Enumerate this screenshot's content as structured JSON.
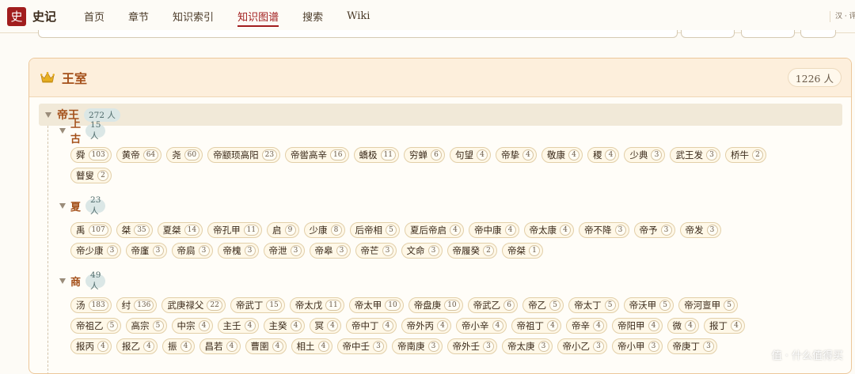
{
  "header": {
    "logo_char": "史",
    "site_title": "史记",
    "nav": [
      "首页",
      "章节",
      "知识索引",
      "知识图谱",
      "搜索",
      "Wiki"
    ],
    "active_nav": "知识图谱",
    "lang_toggle": "汉 · 评"
  },
  "card": {
    "title": "王室",
    "count": "1226 人"
  },
  "category": {
    "title": "帝王",
    "count": "272 人"
  },
  "groups": [
    {
      "title": "上古",
      "count": "15 人",
      "rows": [
        [
          [
            "舜",
            "103"
          ],
          [
            "黄帝",
            "64"
          ],
          [
            "尧",
            "60"
          ],
          [
            "帝颛顼高阳",
            "23"
          ],
          [
            "帝喾高辛",
            "16"
          ],
          [
            "蟜极",
            "11"
          ],
          [
            "穷蝉",
            "6"
          ],
          [
            "句望",
            "4"
          ],
          [
            "帝挚",
            "4"
          ],
          [
            "敬康",
            "4"
          ],
          [
            "稷",
            "4"
          ],
          [
            "少典",
            "3"
          ],
          [
            "武王发",
            "3"
          ],
          [
            "桥牛",
            "2"
          ]
        ],
        [
          [
            "瞽叟",
            "2"
          ]
        ]
      ]
    },
    {
      "title": "夏",
      "count": "23 人",
      "rows": [
        [
          [
            "禹",
            "107"
          ],
          [
            "桀",
            "35"
          ],
          [
            "夏桀",
            "14"
          ],
          [
            "帝孔甲",
            "11"
          ],
          [
            "启",
            "9"
          ],
          [
            "少康",
            "8"
          ],
          [
            "后帝相",
            "5"
          ],
          [
            "夏后帝启",
            "4"
          ],
          [
            "帝中康",
            "4"
          ],
          [
            "帝太康",
            "4"
          ],
          [
            "帝不降",
            "3"
          ],
          [
            "帝予",
            "3"
          ],
          [
            "帝发",
            "3"
          ]
        ],
        [
          [
            "帝少康",
            "3"
          ],
          [
            "帝廑",
            "3"
          ],
          [
            "帝扃",
            "3"
          ],
          [
            "帝槐",
            "3"
          ],
          [
            "帝泄",
            "3"
          ],
          [
            "帝皋",
            "3"
          ],
          [
            "帝芒",
            "3"
          ],
          [
            "文命",
            "3"
          ],
          [
            "帝履癸",
            "2"
          ],
          [
            "帝桀",
            "1"
          ]
        ]
      ]
    },
    {
      "title": "商",
      "count": "49 人",
      "rows": [
        [
          [
            "汤",
            "183"
          ],
          [
            "纣",
            "136"
          ],
          [
            "武庚禄父",
            "22"
          ],
          [
            "帝武丁",
            "15"
          ],
          [
            "帝太戊",
            "11"
          ],
          [
            "帝太甲",
            "10"
          ],
          [
            "帝盘庚",
            "10"
          ],
          [
            "帝武乙",
            "6"
          ],
          [
            "帝乙",
            "5"
          ],
          [
            "帝太丁",
            "5"
          ],
          [
            "帝沃甲",
            "5"
          ],
          [
            "帝河亶甲",
            "5"
          ]
        ],
        [
          [
            "帝祖乙",
            "5"
          ],
          [
            "高宗",
            "5"
          ],
          [
            "中宗",
            "4"
          ],
          [
            "主壬",
            "4"
          ],
          [
            "主癸",
            "4"
          ],
          [
            "冥",
            "4"
          ],
          [
            "帝中丁",
            "4"
          ],
          [
            "帝外丙",
            "4"
          ],
          [
            "帝小辛",
            "4"
          ],
          [
            "帝祖丁",
            "4"
          ],
          [
            "帝辛",
            "4"
          ],
          [
            "帝阳甲",
            "4"
          ],
          [
            "微",
            "4"
          ],
          [
            "报丁",
            "4"
          ]
        ],
        [
          [
            "报丙",
            "4"
          ],
          [
            "报乙",
            "4"
          ],
          [
            "振",
            "4"
          ],
          [
            "昌若",
            "4"
          ],
          [
            "曹圉",
            "4"
          ],
          [
            "相土",
            "4"
          ],
          [
            "帝中壬",
            "3"
          ],
          [
            "帝南庚",
            "3"
          ],
          [
            "帝外壬",
            "3"
          ],
          [
            "帝太庚",
            "3"
          ],
          [
            "帝小乙",
            "3"
          ],
          [
            "帝小甲",
            "3"
          ],
          [
            "帝庚丁",
            "3"
          ]
        ]
      ]
    }
  ],
  "watermark": "值 · 什么值得买"
}
